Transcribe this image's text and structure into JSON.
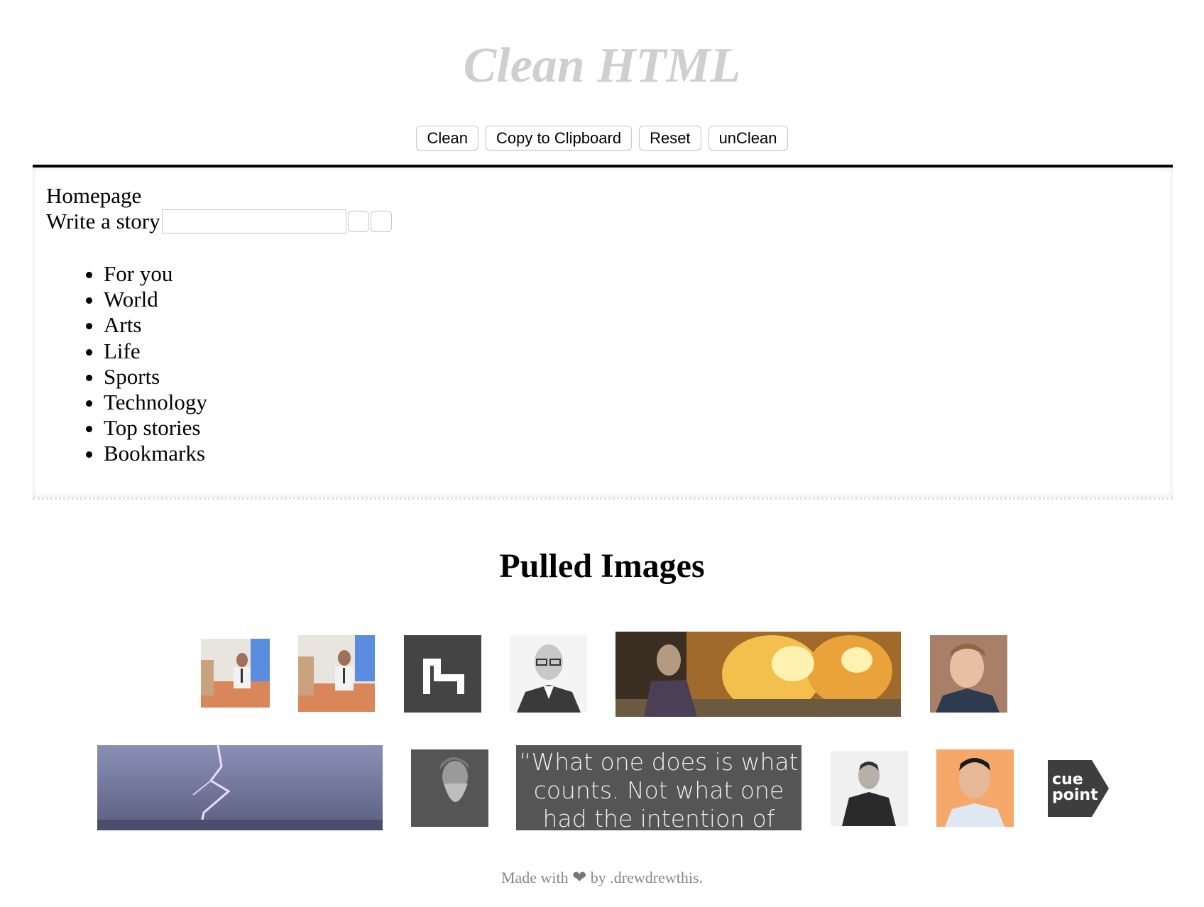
{
  "header": {
    "title": "Clean HTML"
  },
  "toolbar": {
    "clean_label": "Clean",
    "copy_label": "Copy to Clipboard",
    "reset_label": "Reset",
    "unclean_label": "unClean"
  },
  "editor": {
    "homepage": "Homepage",
    "write_story": "Write a story",
    "nav_items": [
      "For you",
      "World",
      "Arts",
      "Life",
      "Sports",
      "Technology",
      "Top stories",
      "Bookmarks"
    ]
  },
  "pulled": {
    "heading": "Pulled Images",
    "quote_line1": "“What one does is what",
    "quote_line2": "counts. Not what one",
    "quote_line3": "had the intention of",
    "logo_line1": "cue",
    "logo_line2": "point"
  },
  "footer": {
    "made_with": "Made with",
    "by": "by .drewdrewthis."
  },
  "icons": {
    "heart": "heart-icon"
  }
}
